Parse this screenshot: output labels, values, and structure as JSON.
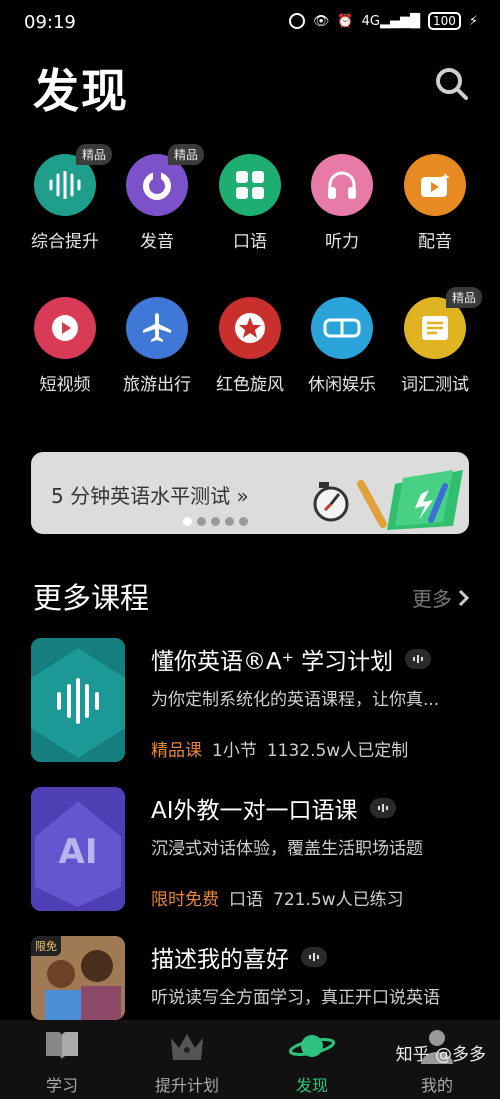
{
  "status": {
    "time": "09:19",
    "battery": "100"
  },
  "header": {
    "title": "发现"
  },
  "grid": [
    {
      "label": "综合提升",
      "badge": "精品",
      "color": "#1f9e8c",
      "icon": "waveform-icon"
    },
    {
      "label": "发音",
      "badge": "精品",
      "color": "#7b52c9",
      "icon": "mouth-icon"
    },
    {
      "label": "口语",
      "badge": "",
      "color": "#1fae72",
      "icon": "grid-icon"
    },
    {
      "label": "听力",
      "badge": "",
      "color": "#e77aa7",
      "icon": "headphones-icon"
    },
    {
      "label": "配音",
      "badge": "",
      "color": "#e88a22",
      "icon": "video-icon"
    },
    {
      "label": "短视频",
      "badge": "",
      "color": "#d83b56",
      "icon": "play-icon"
    },
    {
      "label": "旅游出行",
      "badge": "",
      "color": "#3f78d6",
      "icon": "airplane-icon"
    },
    {
      "label": "红色旋风",
      "badge": "",
      "color": "#c9302c",
      "icon": "star-icon"
    },
    {
      "label": "休闲娱乐",
      "badge": "",
      "color": "#2aa3d8",
      "icon": "vr-goggles-icon"
    },
    {
      "label": "词汇测试",
      "badge": "精品",
      "color": "#e0b322",
      "icon": "newspaper-icon"
    }
  ],
  "banner": {
    "text": "5 分钟英语水平测试 »"
  },
  "section": {
    "title": "更多课程",
    "more": "更多"
  },
  "courses": [
    {
      "title": "懂你英语®A⁺ 学习计划",
      "desc": "为你定制系统化的英语课程，让你真...",
      "tag": "精品课",
      "meta1": "1小节",
      "meta2": "1132.5w人已定制",
      "thumb_color": "#1b8f8a",
      "thumb_text": ""
    },
    {
      "title": "AI外教一对一口语课",
      "desc": "沉浸式对话体验，覆盖生活职场话题",
      "tag": "限时免费",
      "meta1": "口语",
      "meta2": "721.5w人已练习",
      "thumb_color": "#5b4bc4",
      "thumb_text": "AI"
    },
    {
      "title": "描述我的喜好",
      "desc": "听说读写全方面学习，真正开口说英语",
      "tag": "",
      "meta1": "",
      "meta2": "",
      "thumb_color": "#8a6a4a",
      "thumb_badge": "限免"
    }
  ],
  "nav": [
    {
      "label": "学习"
    },
    {
      "label": "提升计划"
    },
    {
      "label": "发现"
    },
    {
      "label": "我的"
    }
  ],
  "watermark": "知乎 @多多"
}
